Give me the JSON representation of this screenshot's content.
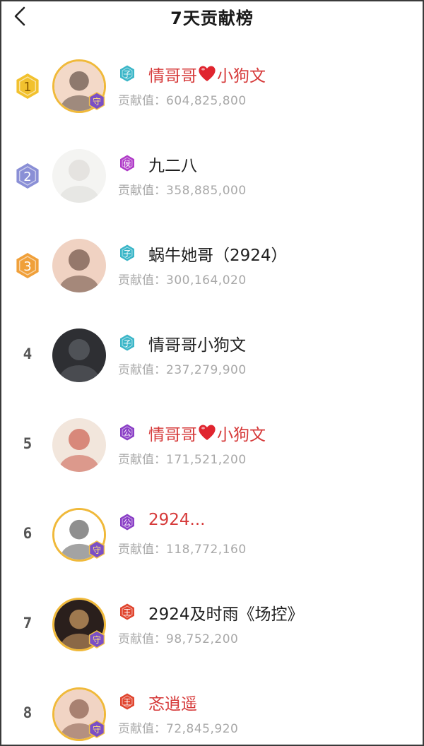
{
  "header": {
    "title": "7天贡献榜",
    "back_icon": "chevron-left-icon"
  },
  "contrib_label": "贡献值：",
  "colors": {
    "name_red": "#d63a3a",
    "rank1": "#f2c12e",
    "rank2": "#8a8fd6",
    "rank3": "#f0a03a",
    "tag_teal": "#3bb6c8",
    "tag_purple": "#8a3fc6",
    "tag_red": "#e0452f",
    "tag_magenta": "#b03cc8"
  },
  "rows": [
    {
      "rank": "1",
      "name": "情哥哥",
      "name_suffix": "小狗文",
      "has_heart": true,
      "name_color": "red",
      "value": "604,825,800",
      "tag": "子",
      "tag_color": "teal",
      "guard": true
    },
    {
      "rank": "2",
      "name": "九二八",
      "name_suffix": "",
      "has_heart": false,
      "name_color": "dark",
      "value": "358,885,000",
      "tag": "侯",
      "tag_color": "magenta",
      "guard": false
    },
    {
      "rank": "3",
      "name": "蜗牛她哥（2924）",
      "name_suffix": "",
      "has_heart": false,
      "name_color": "dark",
      "value": "300,164,020",
      "tag": "子",
      "tag_color": "teal",
      "guard": false
    },
    {
      "rank": "4",
      "name": "情哥哥小狗文",
      "name_suffix": "",
      "has_heart": false,
      "name_color": "dark",
      "value": "237,279,900",
      "tag": "子",
      "tag_color": "teal",
      "guard": false
    },
    {
      "rank": "5",
      "name": "情哥哥",
      "name_suffix": "小狗文",
      "has_heart": true,
      "name_color": "red",
      "value": "171,521,200",
      "tag": "公",
      "tag_color": "purple",
      "guard": false
    },
    {
      "rank": "6",
      "name": "2924...",
      "name_suffix": "",
      "has_heart": false,
      "name_color": "red",
      "value": "118,772,160",
      "tag": "公",
      "tag_color": "purple",
      "guard": true
    },
    {
      "rank": "7",
      "name": "2924及时雨《场控》",
      "name_suffix": "",
      "has_heart": false,
      "name_color": "dark",
      "value": "98,752,200",
      "tag": "王",
      "tag_color": "red",
      "guard": true
    },
    {
      "rank": "8",
      "name": "忞逍遥",
      "name_suffix": "",
      "has_heart": false,
      "name_color": "red",
      "value": "72,845,920",
      "tag": "王",
      "tag_color": "red",
      "guard": true
    }
  ]
}
